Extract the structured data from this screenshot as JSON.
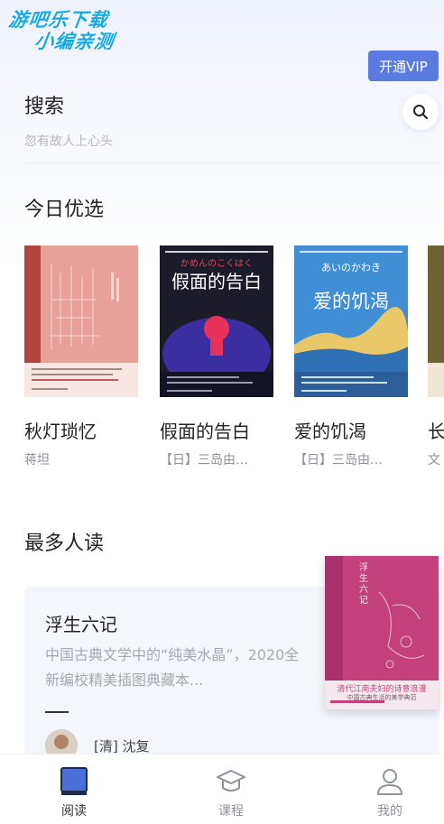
{
  "watermark": {
    "line1": "游吧乐下载",
    "line2": "小编亲测"
  },
  "header": {
    "vip_label": "开通VIP"
  },
  "search": {
    "title": "搜索",
    "placeholder": "忽有故人上心头",
    "icon": "search-icon"
  },
  "today": {
    "title": "今日优选",
    "books": [
      {
        "name": "秋灯琐忆",
        "author": "蒋坦",
        "cover_color": "#e59a90"
      },
      {
        "name": "假面的告白",
        "author": "【日】三岛由…",
        "cover_color": "#1b1b2a",
        "cover_top": "かめんのこくはく",
        "cover_title": "假面的告白"
      },
      {
        "name": "爱的饥渴",
        "author": "【日】三岛由…",
        "cover_color": "#3d8fd4",
        "cover_top": "あいのかわき",
        "cover_title": "爱的饥渴"
      },
      {
        "name": "长",
        "author": "文",
        "cover_color": "#6d6330"
      }
    ]
  },
  "popular": {
    "title": "最多人读",
    "book": {
      "name": "浮生六记",
      "description": "中国古典文学中的“纯美水晶”，2020全新编校精美插图典藏本...",
      "author": "[清] 沈复",
      "cover_color": "#c0417a",
      "cover_title": "浮生六记",
      "cover_band": "清代江南夫妇的诗意浪漫",
      "cover_sub": "中国古典生活的美学典范"
    }
  },
  "tabbar": {
    "tabs": [
      {
        "label": "阅读",
        "icon": "book-icon",
        "active": true
      },
      {
        "label": "课程",
        "icon": "graduation-cap-icon",
        "active": false
      },
      {
        "label": "我的",
        "icon": "user-icon",
        "active": false
      }
    ]
  }
}
